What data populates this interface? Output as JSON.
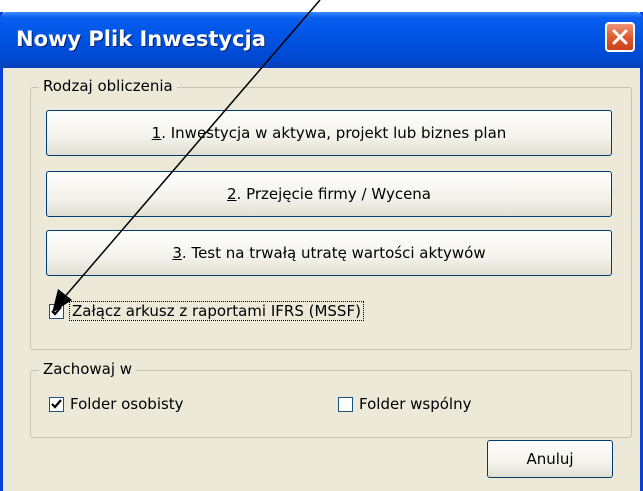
{
  "window": {
    "title": "Nowy Plik Inwestycja"
  },
  "calc_group": {
    "legend": "Rodzaj obliczenia",
    "buttons": [
      {
        "num": "1",
        "rest": ". Inwestycja w aktywa, projekt lub biznes plan"
      },
      {
        "num": "2",
        "rest": ". Przejęcie firmy / Wycena"
      },
      {
        "num": "3",
        "rest": ". Test na trwałą utratę wartości aktywów"
      }
    ],
    "ifrs_checkbox": {
      "label": "Załącz arkusz z raportami IFRS (MSSF)",
      "checked": true
    }
  },
  "save_group": {
    "legend": "Zachowaj w",
    "personal_folder": {
      "label": "Folder osobisty",
      "checked": true
    },
    "shared_folder": {
      "label": "Folder wspólny",
      "checked": false
    }
  },
  "cancel_label": "Anuluj"
}
